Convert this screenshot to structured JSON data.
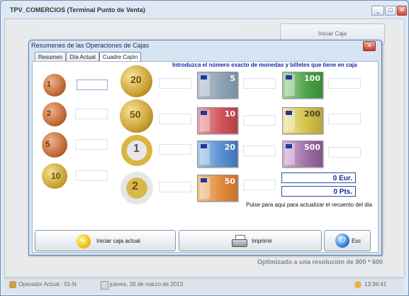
{
  "window": {
    "title": "TPV_COMERCIOS  (Terminal Punto de Venta)",
    "minimize": "_",
    "maximize": "□",
    "close": "✕"
  },
  "banner": "SOLINFOR - SOLUCIONES INFORMATICAS",
  "right_panel": {
    "iniciar_cajas": "Iniciar Caja"
  },
  "footer_note": "Optimizado a una resolución de 800 * 600",
  "status": {
    "operator": "Operador Actual : 01-N",
    "date": "jueves, 28 de marzo de 2013",
    "time": "13:36:41"
  },
  "dialog": {
    "title": "Resumenes de las Operaciones de Cajas",
    "close": "✕",
    "tabs": [
      {
        "label": "Resumen",
        "active": false
      },
      {
        "label": "Día Actual",
        "active": false
      },
      {
        "label": "Cuadre Cajón",
        "active": true
      }
    ],
    "instruction": "Introduzca el número exacto de monedas y billetes que tiene en caja",
    "coins_small": [
      {
        "value": "1",
        "color": "#c8703a"
      },
      {
        "value": "2",
        "color": "#c8703a"
      },
      {
        "value": "5",
        "color": "#c8703a"
      },
      {
        "value": "10",
        "color": "#c9a23a"
      }
    ],
    "coins_large": [
      {
        "value": "20",
        "color": "#c9a23a"
      },
      {
        "value": "50",
        "color": "#c9a23a"
      },
      {
        "value": "1",
        "color": "#d8b948"
      },
      {
        "value": "2",
        "color": "#c9c9c9"
      }
    ],
    "notes_left": [
      {
        "value": "5",
        "color": "#8fa3b6"
      },
      {
        "value": "10",
        "color": "#d0545a"
      },
      {
        "value": "20",
        "color": "#5a8fd0"
      },
      {
        "value": "50",
        "color": "#e08a3a"
      }
    ],
    "notes_right": [
      {
        "value": "100",
        "color": "#4ea24a"
      },
      {
        "value": "200",
        "color": "#d3c24a"
      },
      {
        "value": "500",
        "color": "#a06fa8"
      }
    ],
    "totals": {
      "eur": "0 Eur.",
      "pts": "0 Pts."
    },
    "refresh_hint": "Pulse para aqui para actualizar el recuento del dia",
    "buttons": {
      "iniciar": "Iniciar caja actual",
      "imprimir": "Imprimir",
      "esc": "Esc"
    }
  }
}
